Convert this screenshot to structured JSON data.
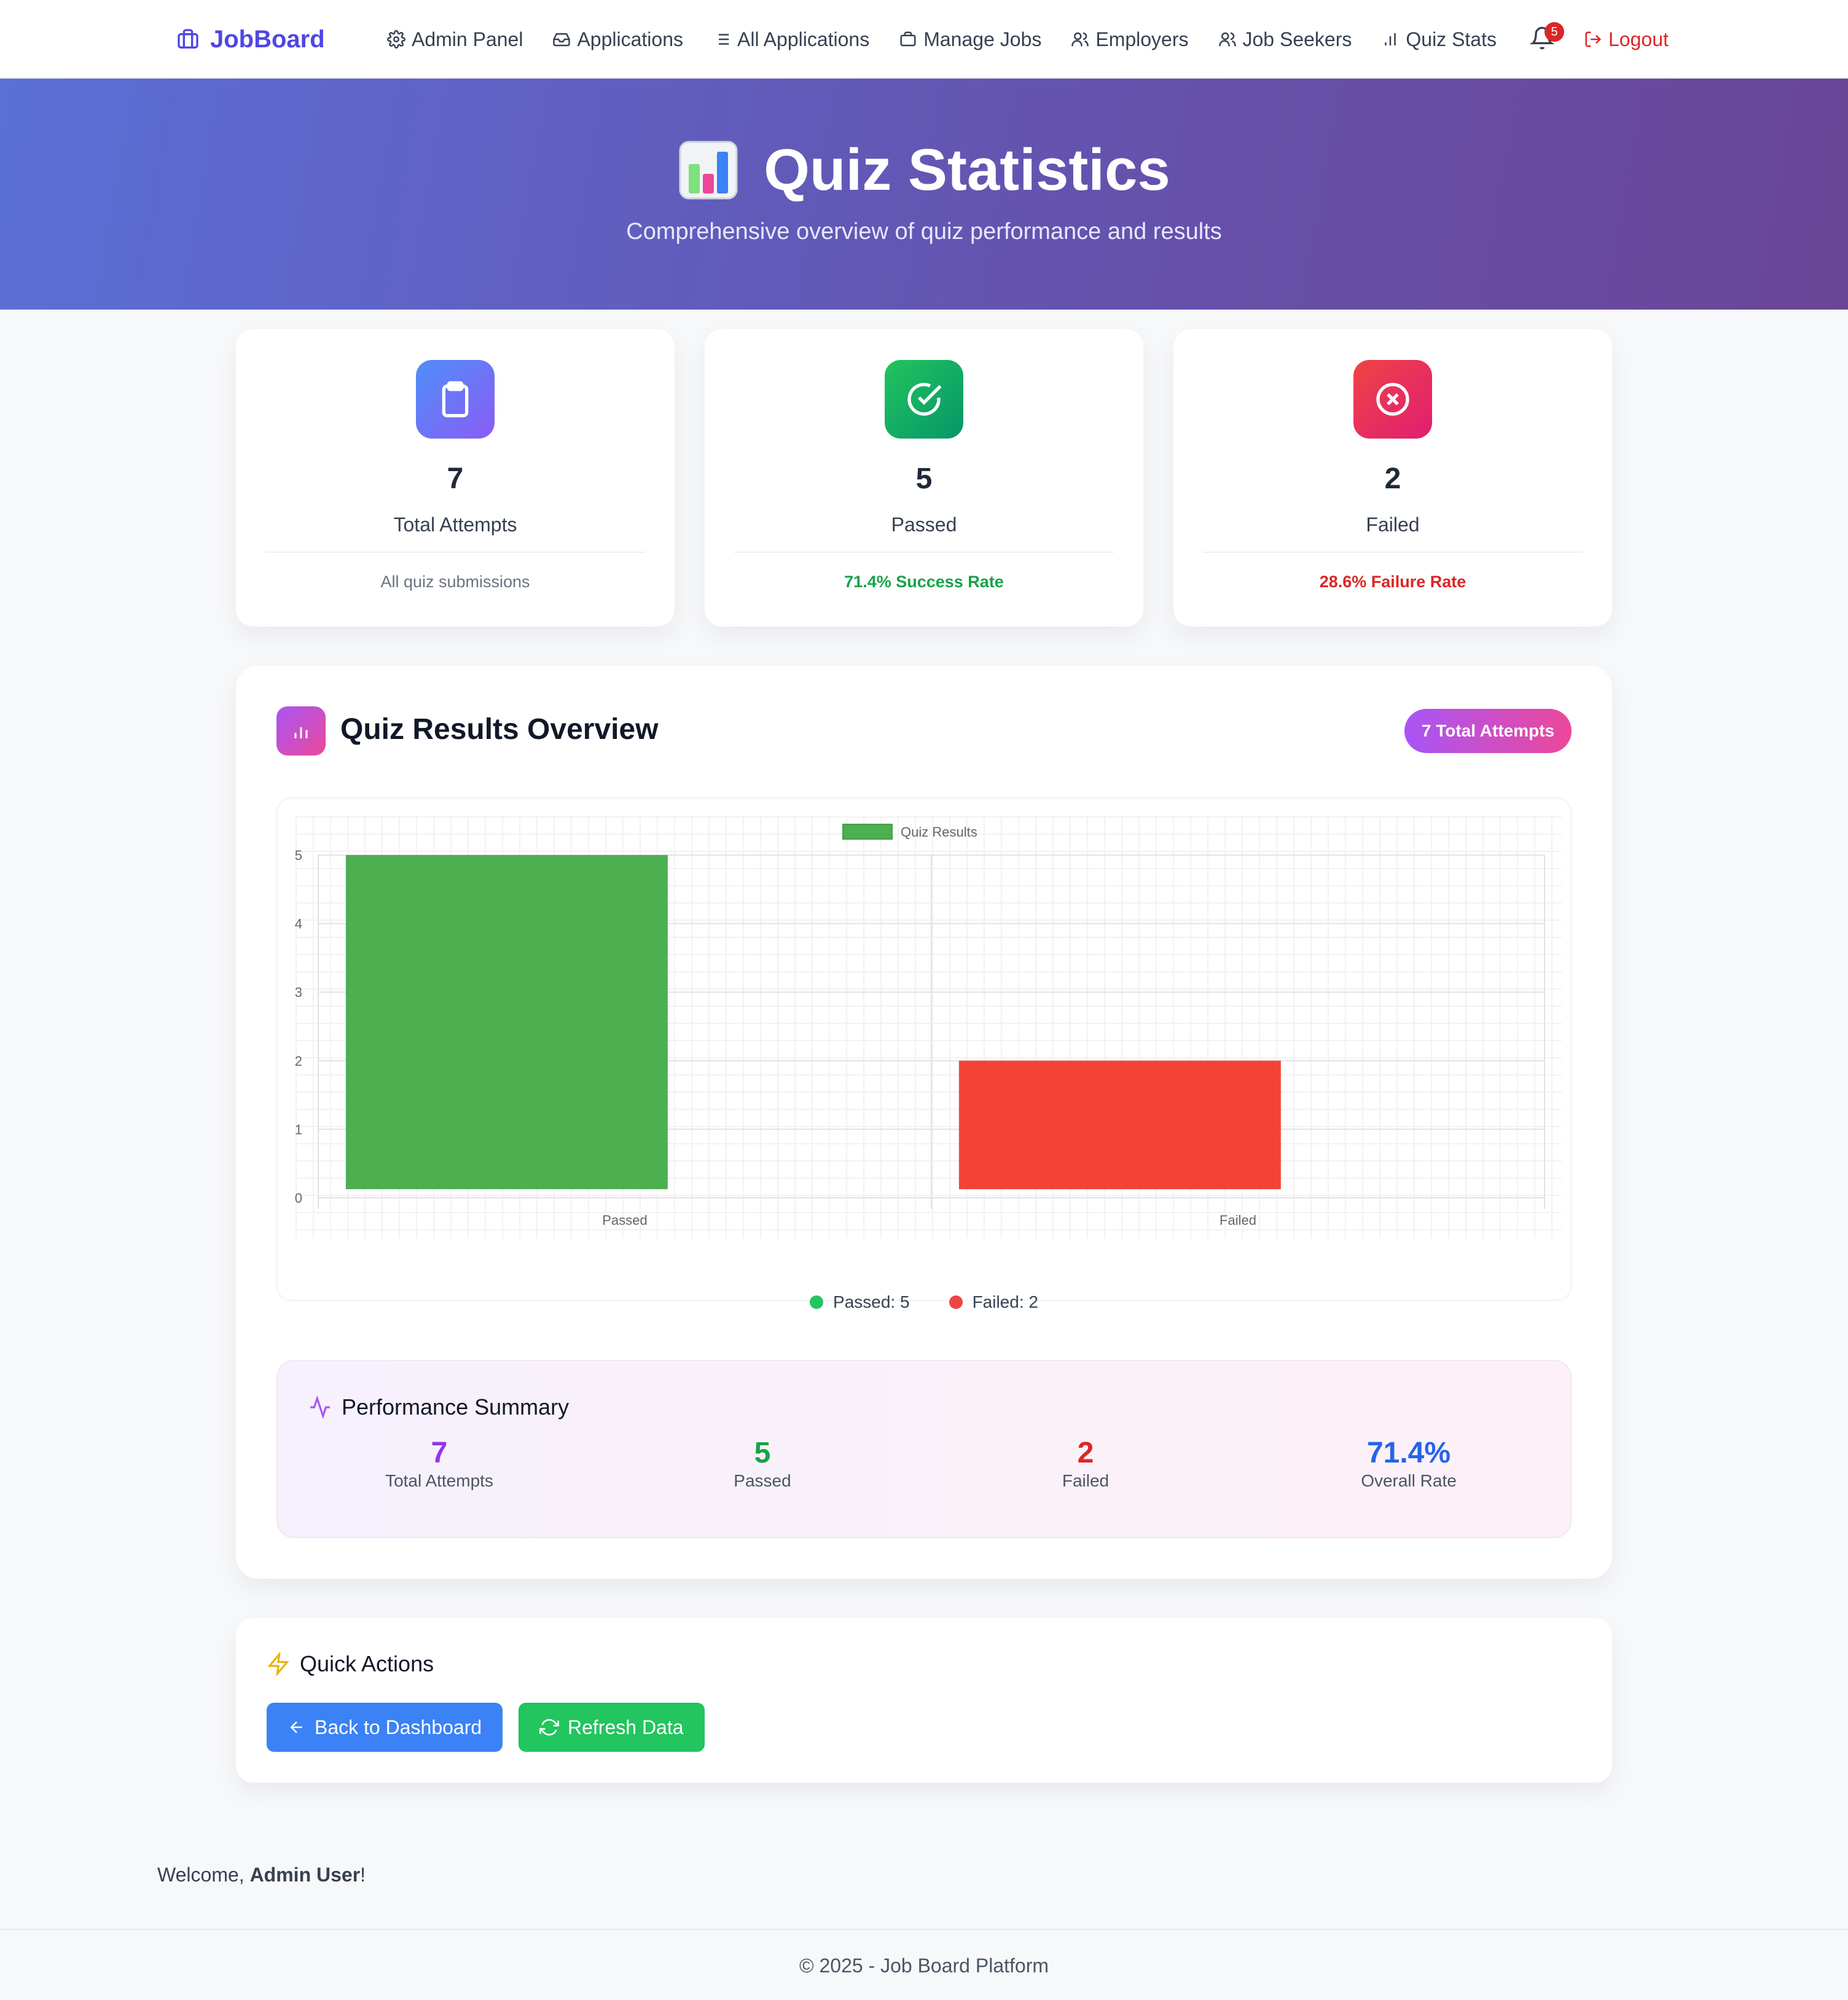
{
  "nav": {
    "brand": "JobBoard",
    "links": [
      {
        "label": "Admin Panel",
        "icon": "gear-icon"
      },
      {
        "label": "Applications",
        "icon": "inbox-icon"
      },
      {
        "label": "All Applications",
        "icon": "list-icon"
      },
      {
        "label": "Manage Jobs",
        "icon": "briefcase-icon"
      },
      {
        "label": "Employers",
        "icon": "users-icon"
      },
      {
        "label": "Job Seekers",
        "icon": "users-icon"
      },
      {
        "label": "Quiz Stats",
        "icon": "bar-chart-icon"
      }
    ],
    "notification_count": "5",
    "logout": "Logout"
  },
  "hero": {
    "title": "Quiz Statistics",
    "subtitle": "Comprehensive overview of quiz performance and results"
  },
  "stats": [
    {
      "value": "7",
      "label": "Total Attempts",
      "foot": "All quiz submissions",
      "icon": "clipboard-icon"
    },
    {
      "value": "5",
      "label": "Passed",
      "foot": "71.4% Success Rate",
      "icon": "check-circle-icon"
    },
    {
      "value": "2",
      "label": "Failed",
      "foot": "28.6% Failure Rate",
      "icon": "x-circle-icon"
    }
  ],
  "overview": {
    "title": "Quiz Results Overview",
    "pill": "7 Total Attempts",
    "legend": [
      {
        "label": "Passed: 5",
        "color": "#22c55e"
      },
      {
        "label": "Failed: 2",
        "color": "#ef4444"
      }
    ]
  },
  "chart_data": {
    "type": "bar",
    "categories": [
      "Passed",
      "Failed"
    ],
    "series": [
      {
        "name": "Quiz Results",
        "values": [
          5,
          2
        ],
        "colors": [
          "#4caf50",
          "#f44336"
        ]
      }
    ],
    "ylim": [
      0,
      5
    ],
    "yticks": [
      0,
      1,
      2,
      3,
      4,
      5
    ],
    "grid": true,
    "legend": "top-center"
  },
  "performance": {
    "title": "Performance Summary",
    "items": [
      {
        "value": "7",
        "label": "Total Attempts",
        "color": "#9333ea"
      },
      {
        "value": "5",
        "label": "Passed",
        "color": "#16a34a"
      },
      {
        "value": "2",
        "label": "Failed",
        "color": "#dc2626"
      },
      {
        "value": "71.4%",
        "label": "Overall Rate",
        "color": "#2563eb"
      }
    ]
  },
  "quick_actions": {
    "title": "Quick Actions",
    "back": "Back to Dashboard",
    "refresh": "Refresh Data"
  },
  "welcome": {
    "prefix": "Welcome, ",
    "user": "Admin User",
    "suffix": "!"
  },
  "footer": "© 2025 - Job Board Platform"
}
